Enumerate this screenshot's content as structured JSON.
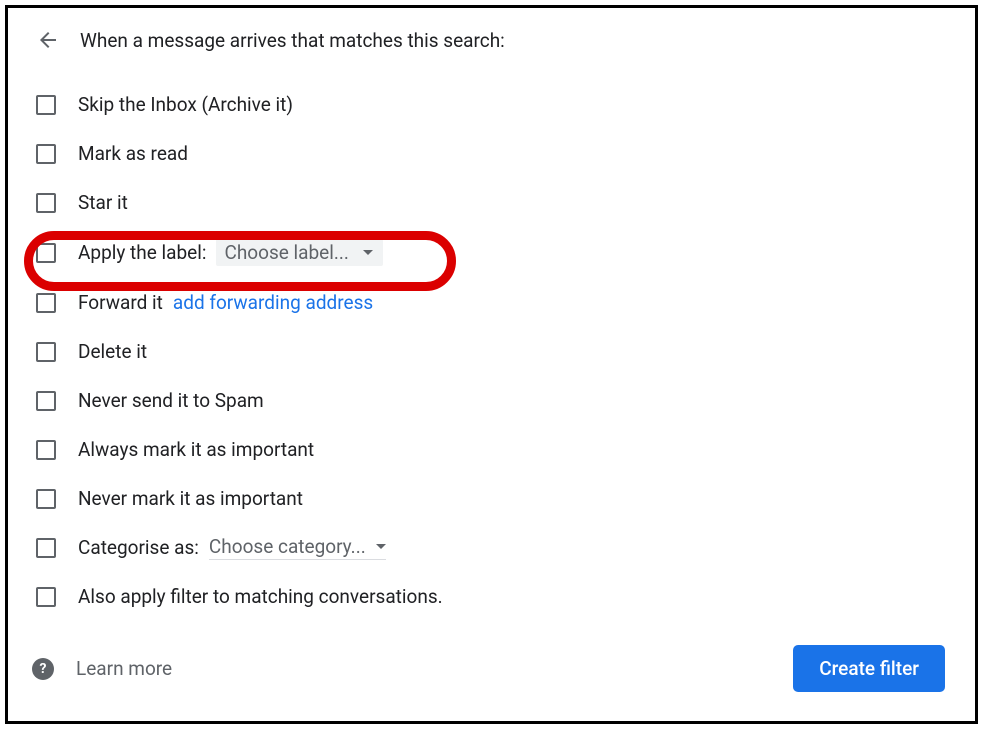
{
  "header": {
    "title": "When a message arrives that matches this search:"
  },
  "options": {
    "skip_inbox": "Skip the Inbox (Archive it)",
    "mark_read": "Mark as read",
    "star_it": "Star it",
    "apply_label": "Apply the label:",
    "apply_label_dropdown": "Choose label...",
    "forward_it": "Forward it",
    "forward_link": "add forwarding address",
    "delete_it": "Delete it",
    "never_spam": "Never send it to Spam",
    "always_important": "Always mark it as important",
    "never_important": "Never mark it as important",
    "categorise_as": "Categorise as:",
    "categorise_dropdown": "Choose category...",
    "also_apply": "Also apply filter to matching conversations."
  },
  "footer": {
    "help_symbol": "?",
    "learn_more": "Learn more",
    "create_button": "Create filter"
  }
}
